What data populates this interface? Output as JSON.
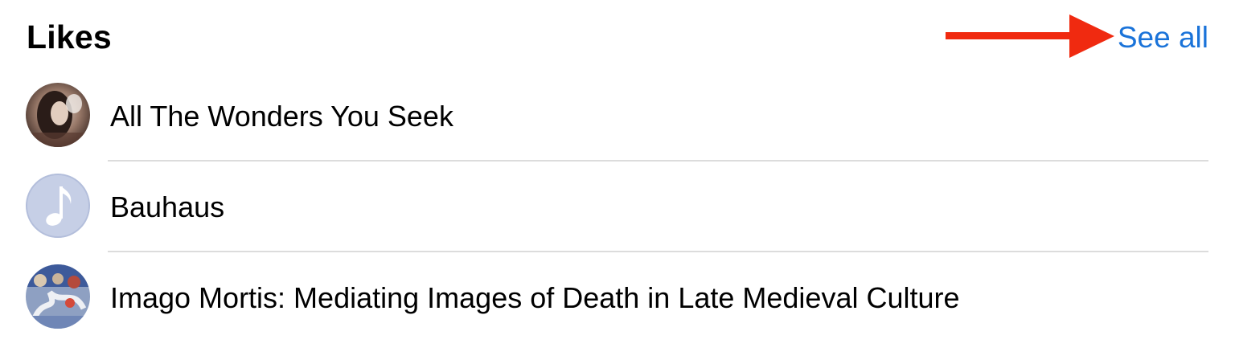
{
  "likes": {
    "title": "Likes",
    "see_all_label": "See all",
    "arrow_color": "#f02a10",
    "link_color": "#1a73d9",
    "items": [
      {
        "label": "All The Wonders You Seek",
        "avatar": "portrait-photo"
      },
      {
        "label": "Bauhaus",
        "avatar": "music-note-icon"
      },
      {
        "label": "Imago Mortis: Mediating Images of Death in Late Medieval Culture",
        "avatar": "medieval-artwork"
      }
    ]
  }
}
